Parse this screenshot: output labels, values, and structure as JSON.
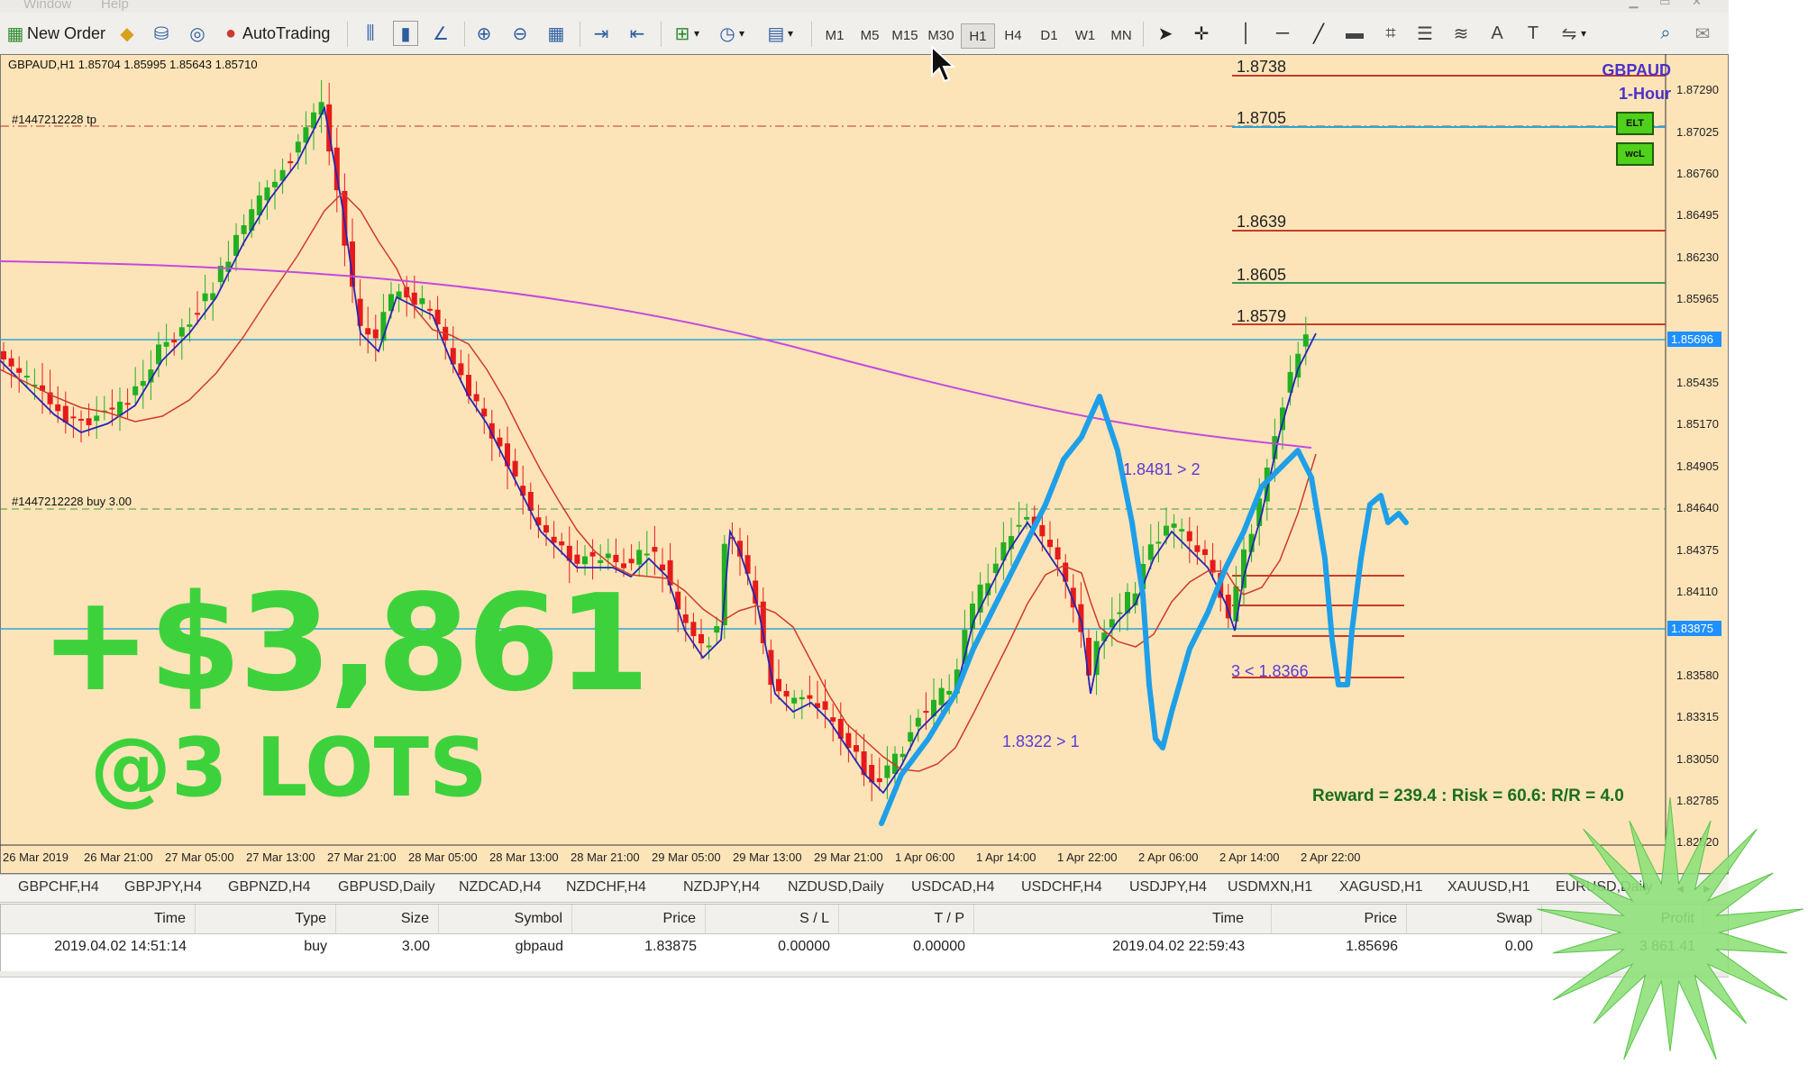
{
  "menu": {
    "window": "Window",
    "help": "Help"
  },
  "toolbar": {
    "new_order": "New Order",
    "autotrading": "AutoTrading",
    "timeframes": [
      "M1",
      "M5",
      "M15",
      "M30",
      "H1",
      "H4",
      "D1",
      "W1",
      "MN"
    ],
    "active_timeframe": "H1"
  },
  "chart": {
    "header": "GBPAUD,H1  1.85704 1.85995 1.85643 1.85710",
    "symbol": "GBPAUD",
    "timeframe": "1-Hour",
    "badge_elt": "ELT",
    "badge_wcl": "wcL",
    "tp_label": "#1447212228 tp",
    "buy_label": "#1447212228 buy 3.00",
    "levels": [
      "1.8738",
      "1.8705",
      "1.8639",
      "1.8605",
      "1.8579"
    ],
    "wave_labels": [
      "1.8481 > 2",
      "1.8322 > 1",
      "3 < 1.8366"
    ],
    "reward_text": "Reward = 239.4 : Risk = 60.6: R/R = 4.0",
    "price_ticks": [
      "1.87290",
      "1.87025",
      "1.86760",
      "1.86495",
      "1.86230",
      "1.85965",
      "1.85435",
      "1.85170",
      "1.84905",
      "1.84640",
      "1.84375",
      "1.84110",
      "1.83580",
      "1.83315",
      "1.83050",
      "1.82785",
      "1.82520"
    ],
    "price_current": "1.85696",
    "price_entry": "1.83875",
    "time_ticks": [
      "26 Mar 2019",
      "26 Mar 21:00",
      "27 Mar 05:00",
      "27 Mar 13:00",
      "27 Mar 21:00",
      "28 Mar 05:00",
      "28 Mar 13:00",
      "28 Mar 21:00",
      "29 Mar 05:00",
      "29 Mar 13:00",
      "29 Mar 21:00",
      "1 Apr 06:00",
      "1 Apr 14:00",
      "1 Apr 22:00",
      "2 Apr 06:00",
      "2 Apr 14:00",
      "2 Apr 22:00"
    ],
    "colors": {
      "background": "#fde4b8",
      "bull": "#21b021",
      "bear": "#e61a1a",
      "wave": "#1e9fe8",
      "ma_fast": "#2525b5",
      "ma_slow": "#d03a2a",
      "ma_long": "#c449e0",
      "profit": "#3dd23b"
    }
  },
  "overlay": {
    "profit": "+$3,861",
    "lots": "@3 LOTS"
  },
  "tabs": [
    "GBPCHF,H4",
    "GBPJPY,H4",
    "GBPNZD,H4",
    "GBPUSD,Daily",
    "NZDCAD,H4",
    "NZDCHF,H4",
    "NZDJPY,H4",
    "NZDUSD,Daily",
    "USDCAD,H4",
    "USDCHF,H4",
    "USDJPY,H4",
    "USDMXN,H1",
    "XAGUSD,H1",
    "XAUUSD,H1",
    "EURUSD,Daily"
  ],
  "trades": {
    "headers": [
      "Time",
      "Type",
      "Size",
      "Symbol",
      "Price",
      "S / L",
      "T / P",
      "Time",
      "Price",
      "Swap",
      "Profit"
    ],
    "row": [
      "2019.04.02 14:51:14",
      "buy",
      "3.00",
      "gbpaud",
      "1.83875",
      "0.00000",
      "0.00000",
      "2019.04.02 22:59:43",
      "1.85696",
      "0.00",
      "3 861.41"
    ]
  }
}
